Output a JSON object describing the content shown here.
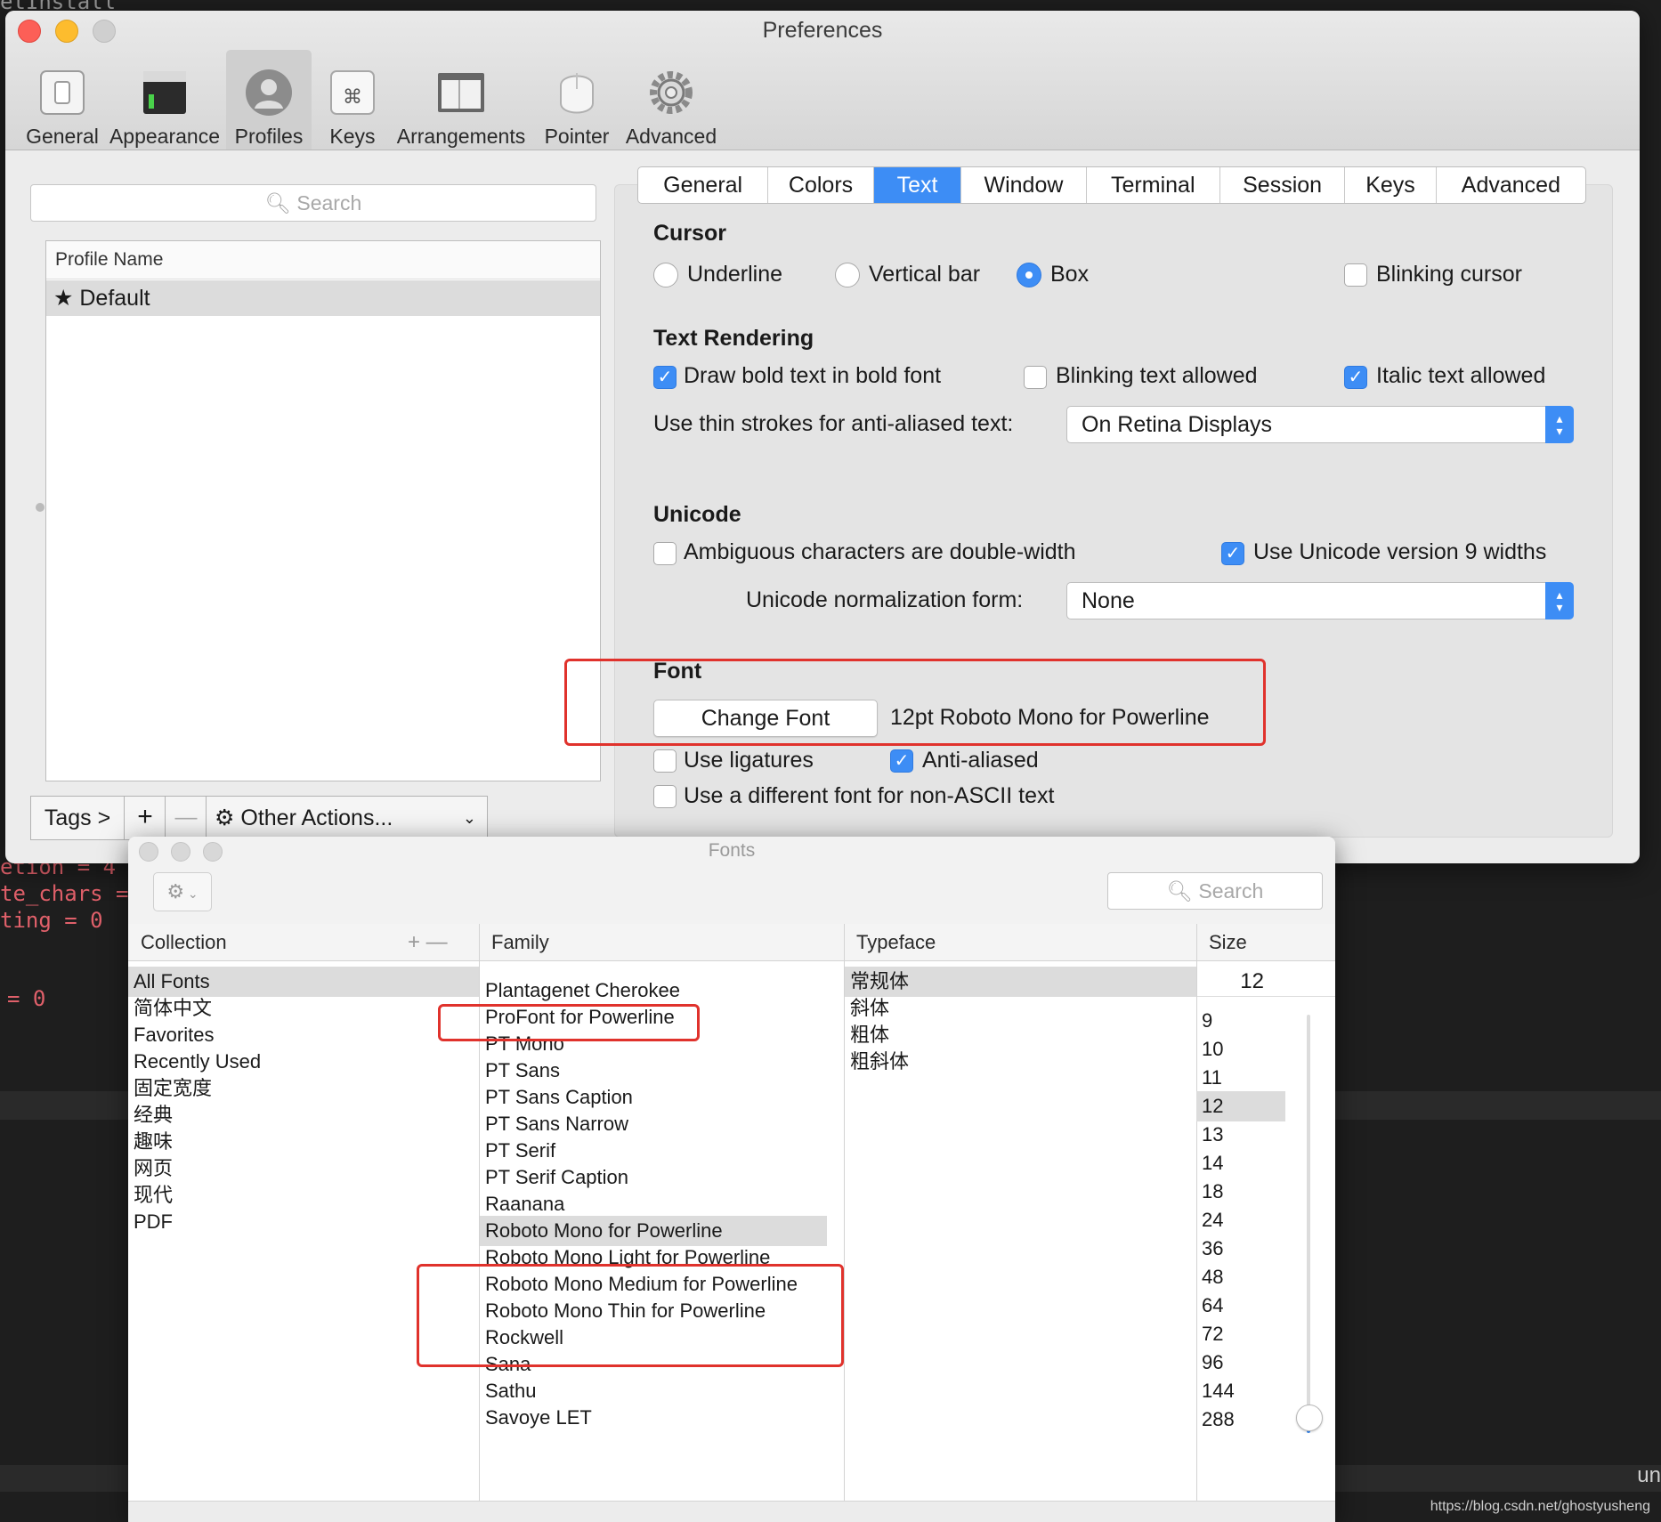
{
  "background": {
    "terminal_lines": [
      "etInstall",
      "etion = 4",
      "te_chars =",
      "ting = 0",
      "= 0"
    ],
    "watermark": "https://blog.csdn.net/ghostyusheng",
    "right_text": "un"
  },
  "prefs": {
    "title": "Preferences",
    "toolbar": [
      "General",
      "Appearance",
      "Profiles",
      "Keys",
      "Arrangements",
      "Pointer",
      "Advanced"
    ],
    "search_placeholder": "Search",
    "profile_header": "Profile Name",
    "profile_default": "★ Default",
    "bottom": {
      "tags": "Tags >",
      "add": "+",
      "remove": "—",
      "other": "Other Actions..."
    },
    "tabs": [
      "General",
      "Colors",
      "Text",
      "Window",
      "Terminal",
      "Session",
      "Keys",
      "Advanced"
    ],
    "selected_tab": "Text",
    "cursor": {
      "heading": "Cursor",
      "underline": "Underline",
      "vertical": "Vertical bar",
      "box": "Box",
      "blinking": "Blinking cursor"
    },
    "rendering": {
      "heading": "Text Rendering",
      "bold": "Draw bold text in bold font",
      "blink": "Blinking text allowed",
      "italic": "Italic text allowed",
      "thin_label": "Use thin strokes for anti-aliased text:",
      "thin_value": "On Retina Displays"
    },
    "unicode": {
      "heading": "Unicode",
      "ambiguous": "Ambiguous characters are double-width",
      "v9": "Use Unicode version 9 widths",
      "norm_label": "Unicode normalization form:",
      "norm_value": "None"
    },
    "font": {
      "heading": "Font",
      "change": "Change Font",
      "current": "12pt Roboto Mono for Powerline",
      "ligatures": "Use ligatures",
      "antialiased": "Anti-aliased",
      "nonascii": "Use a different font for non-ASCII text"
    },
    "accent": "#3d8df5",
    "highlight": "#e0322c"
  },
  "fonts": {
    "title": "Fonts",
    "search_placeholder": "Search",
    "headers": {
      "collection": "Collection",
      "family": "Family",
      "typeface": "Typeface",
      "size": "Size"
    },
    "collection_buttons": "+ —",
    "collections": [
      "All Fonts",
      "简体中文",
      "Favorites",
      "Recently Used",
      "固定宽度",
      "经典",
      "趣味",
      "网页",
      "现代",
      "PDF"
    ],
    "families": [
      "Plantagenet Cherokee",
      "ProFont for Powerline",
      "PT Mono",
      "PT Sans",
      "PT Sans Caption",
      "PT Sans Narrow",
      "PT Serif",
      "PT Serif Caption",
      "Raanana",
      "Roboto Mono for Powerline",
      "Roboto Mono Light for Powerline",
      "Roboto Mono Medium for Powerline",
      "Roboto Mono Thin for Powerline",
      "Rockwell",
      "Sana",
      "Sathu",
      "Savoye LET"
    ],
    "typefaces": [
      "常规体",
      "斜体",
      "粗体",
      "粗斜体"
    ],
    "size_value": "12",
    "sizes": [
      "9",
      "10",
      "11",
      "12",
      "13",
      "14",
      "18",
      "24",
      "36",
      "48",
      "64",
      "72",
      "96",
      "144",
      "288"
    ]
  }
}
